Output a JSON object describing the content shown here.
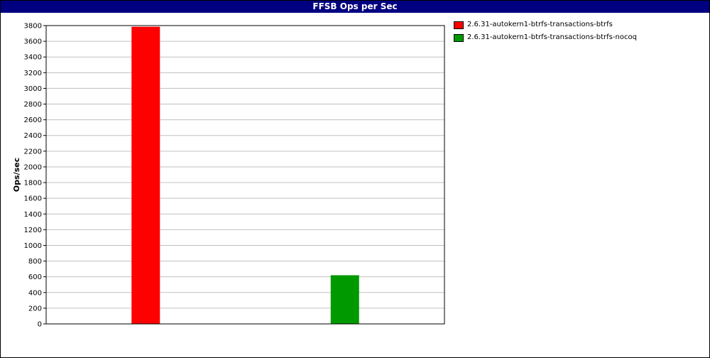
{
  "chart_data": {
    "type": "bar",
    "title": "FFSB Ops per Sec",
    "xlabel": "",
    "ylabel": "Ops/sec",
    "ylim": [
      0,
      3800
    ],
    "yticks": [
      0,
      200,
      400,
      600,
      800,
      1000,
      1200,
      1400,
      1600,
      1800,
      2000,
      2200,
      2400,
      2600,
      2800,
      3000,
      3200,
      3400,
      3600,
      3800
    ],
    "grid": true,
    "legend_position": "right",
    "series": [
      {
        "name": "2.6.31-autokern1-btrfs-transactions-btrfs",
        "values": [
          3785
        ],
        "color": "#ff0000"
      },
      {
        "name": "2.6.31-autokern1-btrfs-transactions-btrfs-nocoq",
        "values": [
          620
        ],
        "color": "#009900"
      }
    ]
  }
}
